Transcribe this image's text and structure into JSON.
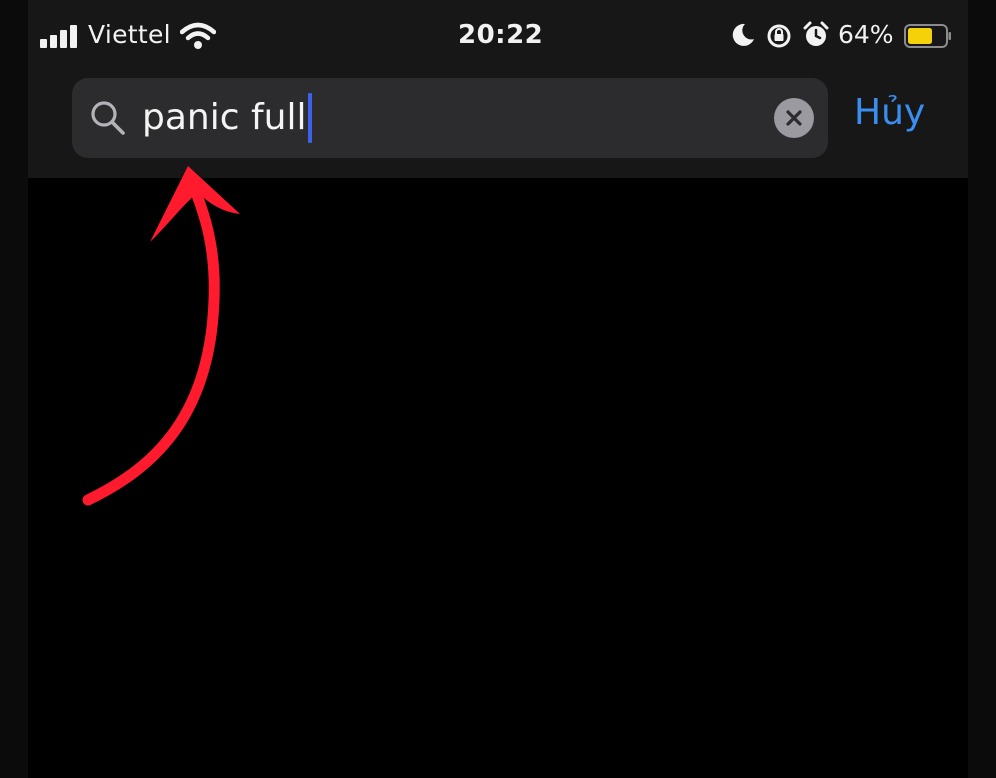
{
  "status_bar": {
    "carrier": "Viettel",
    "time": "20:22",
    "battery_percent": "64%",
    "icons": [
      "signal-icon",
      "wifi-icon",
      "moon-icon",
      "rotation-lock-icon",
      "alarm-icon",
      "battery-icon"
    ],
    "battery_color": "#f5d10a"
  },
  "search": {
    "value": "panic full",
    "icon": "search-icon",
    "clear_icon": "close-icon"
  },
  "cancel_label": "Hủy",
  "colors": {
    "accent": "#3a8ef0",
    "annotation_arrow": "#ff1a2e",
    "caret": "#3b62e8"
  }
}
